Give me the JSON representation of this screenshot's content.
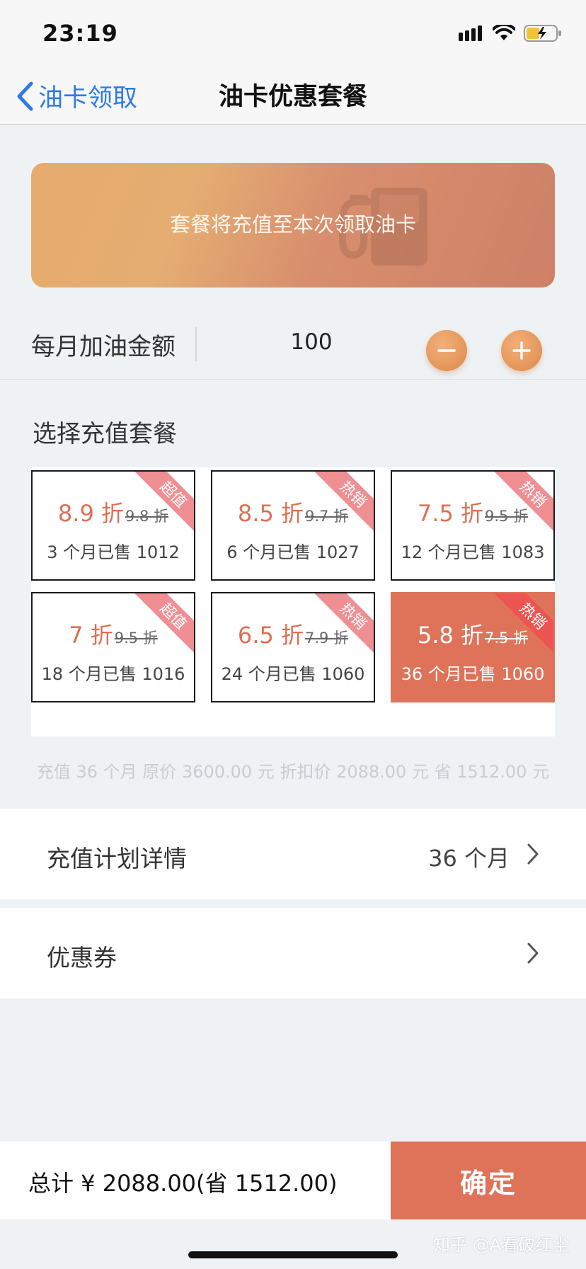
{
  "status_bar": {
    "time": "23:19"
  },
  "nav": {
    "back_label": "油卡领取",
    "title": "油卡优惠套餐"
  },
  "banner": {
    "text": "套餐将充值至本次领取油卡",
    "icon": "fuel-pump-icon"
  },
  "amount": {
    "label": "每月加油金额",
    "value": "100"
  },
  "packages": {
    "title": "选择充值套餐",
    "items": [
      {
        "discount": "8.9 折",
        "original": "9.8 折",
        "sold": "3 个月已售 1012",
        "tag": "超值",
        "selected": false
      },
      {
        "discount": "8.5 折",
        "original": "9.7 折",
        "sold": "6 个月已售 1027",
        "tag": "热销",
        "selected": false
      },
      {
        "discount": "7.5 折",
        "original": "9.5 折",
        "sold": "12 个月已售 1083",
        "tag": "热销",
        "selected": false
      },
      {
        "discount": "7 折",
        "original": "9.5 折",
        "sold": "18 个月已售 1016",
        "tag": "超值",
        "selected": false
      },
      {
        "discount": "6.5 折",
        "original": "7.9 折",
        "sold": "24 个月已售 1060",
        "tag": "热销",
        "selected": false
      },
      {
        "discount": "5.8 折",
        "original": "7.5 折",
        "sold": "36 个月已售 1060",
        "tag": "热销",
        "selected": true
      }
    ],
    "summary": "充值 36 个月 原价 3600.00 元 折扣价 2088.00 元 省 1512.00 元"
  },
  "plan_row": {
    "label": "充值计划详情",
    "value": "36 个月"
  },
  "coupon_row": {
    "label": "优惠券"
  },
  "footer": {
    "total": "总计 ¥ 2088.00(省 1512.00)",
    "confirm": "确定"
  },
  "watermark": "知乎 @A看破红尘",
  "colors": {
    "accent": "#de735a",
    "link": "#2f7ae5",
    "ribbon": "#ef8f93"
  }
}
